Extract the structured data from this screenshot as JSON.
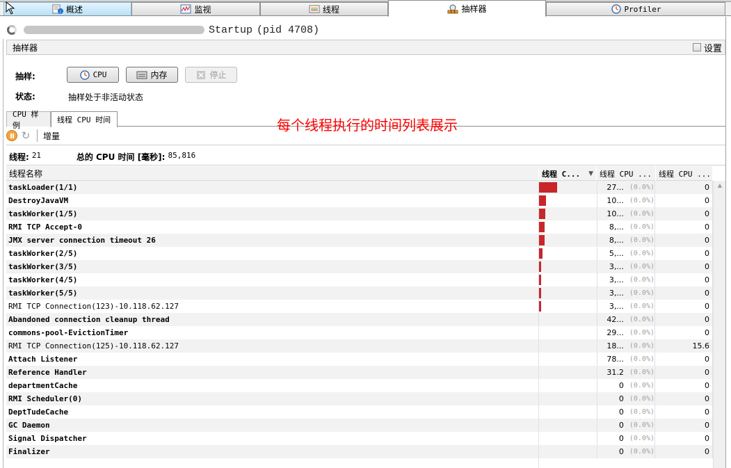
{
  "tabs": [
    {
      "label": "概述",
      "icon": "overview-icon"
    },
    {
      "label": "监视",
      "icon": "monitor-chart-icon"
    },
    {
      "label": "线程",
      "icon": "threads-icon"
    },
    {
      "label": "抽样器",
      "icon": "sampler-icon",
      "active": true
    },
    {
      "label": "Profiler",
      "icon": "clock-icon"
    }
  ],
  "title": {
    "app_suffix": "Startup",
    "pid_text": "(pid 4708)"
  },
  "panel": {
    "title": "抽样器",
    "settings_label": "设置",
    "settings_checked": false
  },
  "sampling": {
    "label": "抽样:",
    "buttons": {
      "cpu": "CPU",
      "memory": "内存",
      "stop": "停止"
    },
    "status_label": "状态:",
    "status_value": "抽样处于非活动状态"
  },
  "subtabs": [
    {
      "label": "CPU 样例"
    },
    {
      "label": "线程 CPU 时间",
      "active": true
    }
  ],
  "annotation": "每个线程执行的时间列表展示",
  "toolbar": {
    "delta_label": "增量"
  },
  "summary": {
    "threads_label": "线程:",
    "threads_value": "21",
    "total_label": "总的 CPU 时间 [毫秒]:",
    "total_value": "85,816"
  },
  "table": {
    "columns": [
      "线程名称",
      "线程 C...",
      "线程 CPU ...",
      "线程 CPU ..."
    ],
    "sorted_column": 1,
    "rows": [
      {
        "name": "taskLoader(1/1)",
        "bar": 0.32,
        "time": "27...",
        "pct": "(0.0%)",
        "cpu": "0",
        "bold": true
      },
      {
        "name": "DestroyJavaVM",
        "bar": 0.12,
        "time": "10...",
        "pct": "(0.0%)",
        "cpu": "0",
        "bold": true
      },
      {
        "name": "taskWorker(1/5)",
        "bar": 0.11,
        "time": "10...",
        "pct": "(0.0%)",
        "cpu": "0",
        "bold": true
      },
      {
        "name": "RMI TCP Accept-0",
        "bar": 0.095,
        "time": "8,...",
        "pct": "(0.0%)",
        "cpu": "0",
        "bold": true
      },
      {
        "name": "JMX server connection timeout 26",
        "bar": 0.095,
        "time": "8,...",
        "pct": "(0.0%)",
        "cpu": "0",
        "bold": true
      },
      {
        "name": "taskWorker(2/5)",
        "bar": 0.06,
        "time": "5,...",
        "pct": "(0.0%)",
        "cpu": "0",
        "bold": true
      },
      {
        "name": "taskWorker(3/5)",
        "bar": 0.037,
        "time": "3,...",
        "pct": "(0.0%)",
        "cpu": "0",
        "bold": true
      },
      {
        "name": "taskWorker(4/5)",
        "bar": 0.037,
        "time": "3,...",
        "pct": "(0.0%)",
        "cpu": "0",
        "bold": true
      },
      {
        "name": "taskWorker(5/5)",
        "bar": 0.037,
        "time": "3,...",
        "pct": "(0.0%)",
        "cpu": "0",
        "bold": true
      },
      {
        "name": "RMI TCP Connection(123)-10.118.62.127",
        "bar": 0.037,
        "time": "3,...",
        "pct": "(0.0%)",
        "cpu": "0",
        "bold": false
      },
      {
        "name": "Abandoned connection cleanup thread",
        "bar": 0,
        "time": "42...",
        "pct": "(0.0%)",
        "cpu": "0",
        "bold": true
      },
      {
        "name": "commons-pool-EvictionTimer",
        "bar": 0,
        "time": "29...",
        "pct": "(0.0%)",
        "cpu": "0",
        "bold": true
      },
      {
        "name": "RMI TCP Connection(125)-10.118.62.127",
        "bar": 0,
        "time": "18...",
        "pct": "(0.0%)",
        "cpu": "15.6",
        "bold": false
      },
      {
        "name": "Attach Listener",
        "bar": 0,
        "time": "78...",
        "pct": "(0.0%)",
        "cpu": "0",
        "bold": true
      },
      {
        "name": "Reference Handler",
        "bar": 0,
        "time": "31.2",
        "pct": "(0.0%)",
        "cpu": "0",
        "bold": true
      },
      {
        "name": "departmentCache",
        "bar": 0,
        "time": "0",
        "pct": "(0.0%)",
        "cpu": "0",
        "bold": true
      },
      {
        "name": "RMI Scheduler(0)",
        "bar": 0,
        "time": "0",
        "pct": "(0.0%)",
        "cpu": "0",
        "bold": true
      },
      {
        "name": "DeptTudeCache",
        "bar": 0,
        "time": "0",
        "pct": "(0.0%)",
        "cpu": "0",
        "bold": true
      },
      {
        "name": "GC Daemon",
        "bar": 0,
        "time": "0",
        "pct": "(0.0%)",
        "cpu": "0",
        "bold": true
      },
      {
        "name": "Signal Dispatcher",
        "bar": 0,
        "time": "0",
        "pct": "(0.0%)",
        "cpu": "0",
        "bold": true
      },
      {
        "name": "Finalizer",
        "bar": 0,
        "time": "0",
        "pct": "(0.0%)",
        "cpu": "0",
        "bold": true
      }
    ]
  },
  "colors": {
    "bar": "#c8262a",
    "annotation": "#ff0000"
  }
}
